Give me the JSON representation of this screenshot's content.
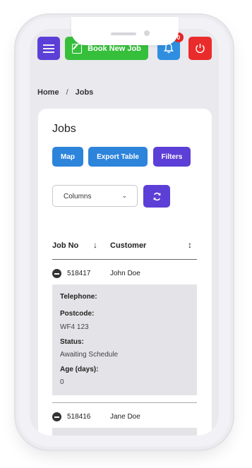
{
  "topbar": {
    "book_label": "Book New Job",
    "notification_count": "0"
  },
  "breadcrumb": {
    "home": "Home",
    "separator": "/",
    "current": "Jobs"
  },
  "page": {
    "title": "Jobs",
    "buttons": {
      "map": "Map",
      "export": "Export Table",
      "filters": "Filters"
    },
    "columns_select": "Columns"
  },
  "table": {
    "headers": {
      "job_no": "Job No",
      "sort_icon_1": "↓",
      "customer": "Customer",
      "sort_icon_2": "↕"
    },
    "rows": [
      {
        "job_no": "518417",
        "customer": "John Doe",
        "details": {
          "telephone_label": "Telephone:",
          "postcode_label": "Postcode:",
          "postcode": "WF4 123",
          "status_label": "Status:",
          "status": "Awaiting Schedule",
          "age_label": "Age (days):",
          "age": "0"
        }
      },
      {
        "job_no": "518416",
        "customer": "Jane Doe"
      }
    ]
  },
  "colors": {
    "purple": "#5b3fd6",
    "green": "#36bf3b",
    "blue": "#2d84db",
    "red": "#ea2b2b"
  }
}
